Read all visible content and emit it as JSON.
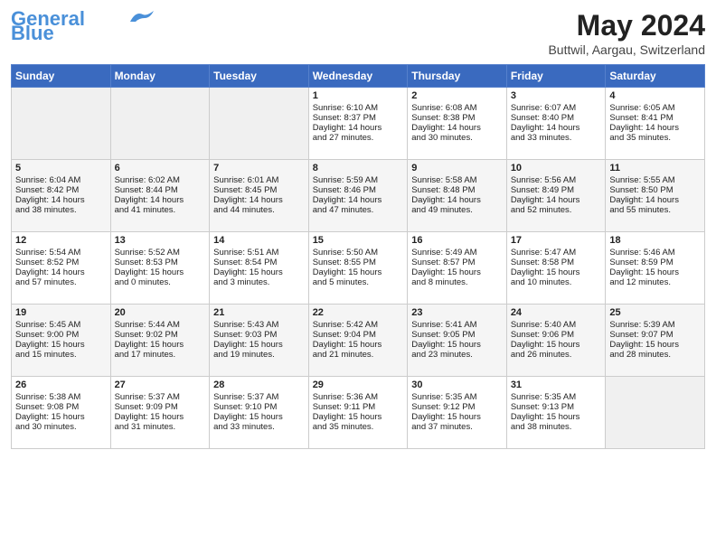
{
  "header": {
    "logo_line1": "General",
    "logo_line2": "Blue",
    "month_year": "May 2024",
    "location": "Buttwil, Aargau, Switzerland"
  },
  "days_of_week": [
    "Sunday",
    "Monday",
    "Tuesday",
    "Wednesday",
    "Thursday",
    "Friday",
    "Saturday"
  ],
  "weeks": [
    [
      {
        "day": "",
        "content": ""
      },
      {
        "day": "",
        "content": ""
      },
      {
        "day": "",
        "content": ""
      },
      {
        "day": "1",
        "content": "Sunrise: 6:10 AM\nSunset: 8:37 PM\nDaylight: 14 hours\nand 27 minutes."
      },
      {
        "day": "2",
        "content": "Sunrise: 6:08 AM\nSunset: 8:38 PM\nDaylight: 14 hours\nand 30 minutes."
      },
      {
        "day": "3",
        "content": "Sunrise: 6:07 AM\nSunset: 8:40 PM\nDaylight: 14 hours\nand 33 minutes."
      },
      {
        "day": "4",
        "content": "Sunrise: 6:05 AM\nSunset: 8:41 PM\nDaylight: 14 hours\nand 35 minutes."
      }
    ],
    [
      {
        "day": "5",
        "content": "Sunrise: 6:04 AM\nSunset: 8:42 PM\nDaylight: 14 hours\nand 38 minutes."
      },
      {
        "day": "6",
        "content": "Sunrise: 6:02 AM\nSunset: 8:44 PM\nDaylight: 14 hours\nand 41 minutes."
      },
      {
        "day": "7",
        "content": "Sunrise: 6:01 AM\nSunset: 8:45 PM\nDaylight: 14 hours\nand 44 minutes."
      },
      {
        "day": "8",
        "content": "Sunrise: 5:59 AM\nSunset: 8:46 PM\nDaylight: 14 hours\nand 47 minutes."
      },
      {
        "day": "9",
        "content": "Sunrise: 5:58 AM\nSunset: 8:48 PM\nDaylight: 14 hours\nand 49 minutes."
      },
      {
        "day": "10",
        "content": "Sunrise: 5:56 AM\nSunset: 8:49 PM\nDaylight: 14 hours\nand 52 minutes."
      },
      {
        "day": "11",
        "content": "Sunrise: 5:55 AM\nSunset: 8:50 PM\nDaylight: 14 hours\nand 55 minutes."
      }
    ],
    [
      {
        "day": "12",
        "content": "Sunrise: 5:54 AM\nSunset: 8:52 PM\nDaylight: 14 hours\nand 57 minutes."
      },
      {
        "day": "13",
        "content": "Sunrise: 5:52 AM\nSunset: 8:53 PM\nDaylight: 15 hours\nand 0 minutes."
      },
      {
        "day": "14",
        "content": "Sunrise: 5:51 AM\nSunset: 8:54 PM\nDaylight: 15 hours\nand 3 minutes."
      },
      {
        "day": "15",
        "content": "Sunrise: 5:50 AM\nSunset: 8:55 PM\nDaylight: 15 hours\nand 5 minutes."
      },
      {
        "day": "16",
        "content": "Sunrise: 5:49 AM\nSunset: 8:57 PM\nDaylight: 15 hours\nand 8 minutes."
      },
      {
        "day": "17",
        "content": "Sunrise: 5:47 AM\nSunset: 8:58 PM\nDaylight: 15 hours\nand 10 minutes."
      },
      {
        "day": "18",
        "content": "Sunrise: 5:46 AM\nSunset: 8:59 PM\nDaylight: 15 hours\nand 12 minutes."
      }
    ],
    [
      {
        "day": "19",
        "content": "Sunrise: 5:45 AM\nSunset: 9:00 PM\nDaylight: 15 hours\nand 15 minutes."
      },
      {
        "day": "20",
        "content": "Sunrise: 5:44 AM\nSunset: 9:02 PM\nDaylight: 15 hours\nand 17 minutes."
      },
      {
        "day": "21",
        "content": "Sunrise: 5:43 AM\nSunset: 9:03 PM\nDaylight: 15 hours\nand 19 minutes."
      },
      {
        "day": "22",
        "content": "Sunrise: 5:42 AM\nSunset: 9:04 PM\nDaylight: 15 hours\nand 21 minutes."
      },
      {
        "day": "23",
        "content": "Sunrise: 5:41 AM\nSunset: 9:05 PM\nDaylight: 15 hours\nand 23 minutes."
      },
      {
        "day": "24",
        "content": "Sunrise: 5:40 AM\nSunset: 9:06 PM\nDaylight: 15 hours\nand 26 minutes."
      },
      {
        "day": "25",
        "content": "Sunrise: 5:39 AM\nSunset: 9:07 PM\nDaylight: 15 hours\nand 28 minutes."
      }
    ],
    [
      {
        "day": "26",
        "content": "Sunrise: 5:38 AM\nSunset: 9:08 PM\nDaylight: 15 hours\nand 30 minutes."
      },
      {
        "day": "27",
        "content": "Sunrise: 5:37 AM\nSunset: 9:09 PM\nDaylight: 15 hours\nand 31 minutes."
      },
      {
        "day": "28",
        "content": "Sunrise: 5:37 AM\nSunset: 9:10 PM\nDaylight: 15 hours\nand 33 minutes."
      },
      {
        "day": "29",
        "content": "Sunrise: 5:36 AM\nSunset: 9:11 PM\nDaylight: 15 hours\nand 35 minutes."
      },
      {
        "day": "30",
        "content": "Sunrise: 5:35 AM\nSunset: 9:12 PM\nDaylight: 15 hours\nand 37 minutes."
      },
      {
        "day": "31",
        "content": "Sunrise: 5:35 AM\nSunset: 9:13 PM\nDaylight: 15 hours\nand 38 minutes."
      },
      {
        "day": "",
        "content": ""
      }
    ]
  ]
}
